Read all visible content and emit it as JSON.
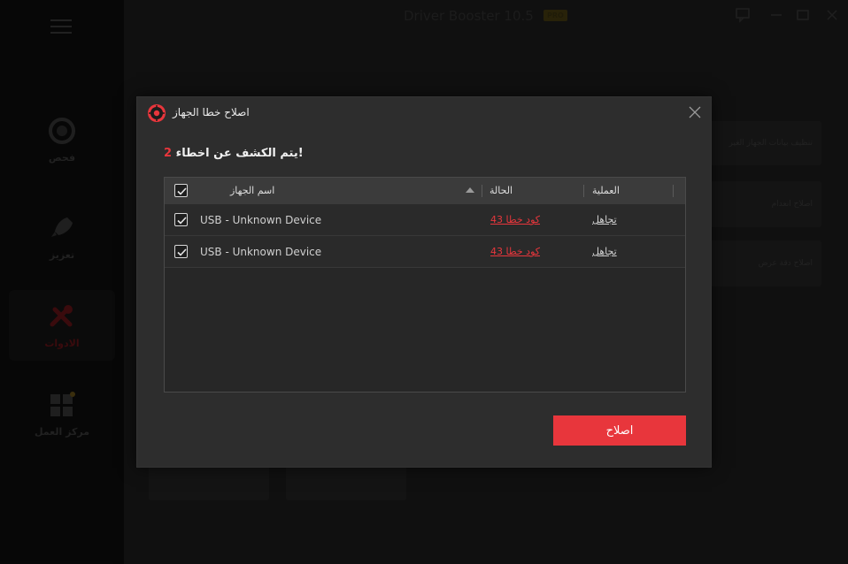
{
  "app": {
    "title": "Driver Booster 10.5",
    "badge": "PRO",
    "sidebar": [
      {
        "label": "فحص",
        "icon": "scan-icon"
      },
      {
        "label": "تعزيز",
        "icon": "rocket-icon"
      },
      {
        "label": "الادوات",
        "icon": "tools-icon",
        "active": true
      },
      {
        "label": "مركز العمل",
        "icon": "action-center-icon"
      }
    ],
    "cards": [
      {
        "label": "تنظيف بيانات الجهاز الغير"
      },
      {
        "label": "اصلاح انعدام"
      },
      {
        "label": "اصلاح دقة عرض"
      }
    ]
  },
  "dialog": {
    "title": "اصلاح خطا الجهاز",
    "detected_prefix": "!يتم الكشف عن اخطاء",
    "detected_count": "2",
    "table": {
      "col_name": "اسم الجهاز",
      "col_status": "الحالة",
      "col_action": "العملية",
      "rows": [
        {
          "device": "USB - Unknown Device",
          "status": "كود خطا 43",
          "action": "تجاهل"
        },
        {
          "device": "USB - Unknown Device",
          "status": "كود خطا 43",
          "action": "تجاهل"
        }
      ]
    },
    "fix_button": "اصلاح"
  },
  "colors": {
    "accent": "#e8363c",
    "dialog_bg": "#2d2d2d",
    "header_bg": "#3b3b3b"
  }
}
